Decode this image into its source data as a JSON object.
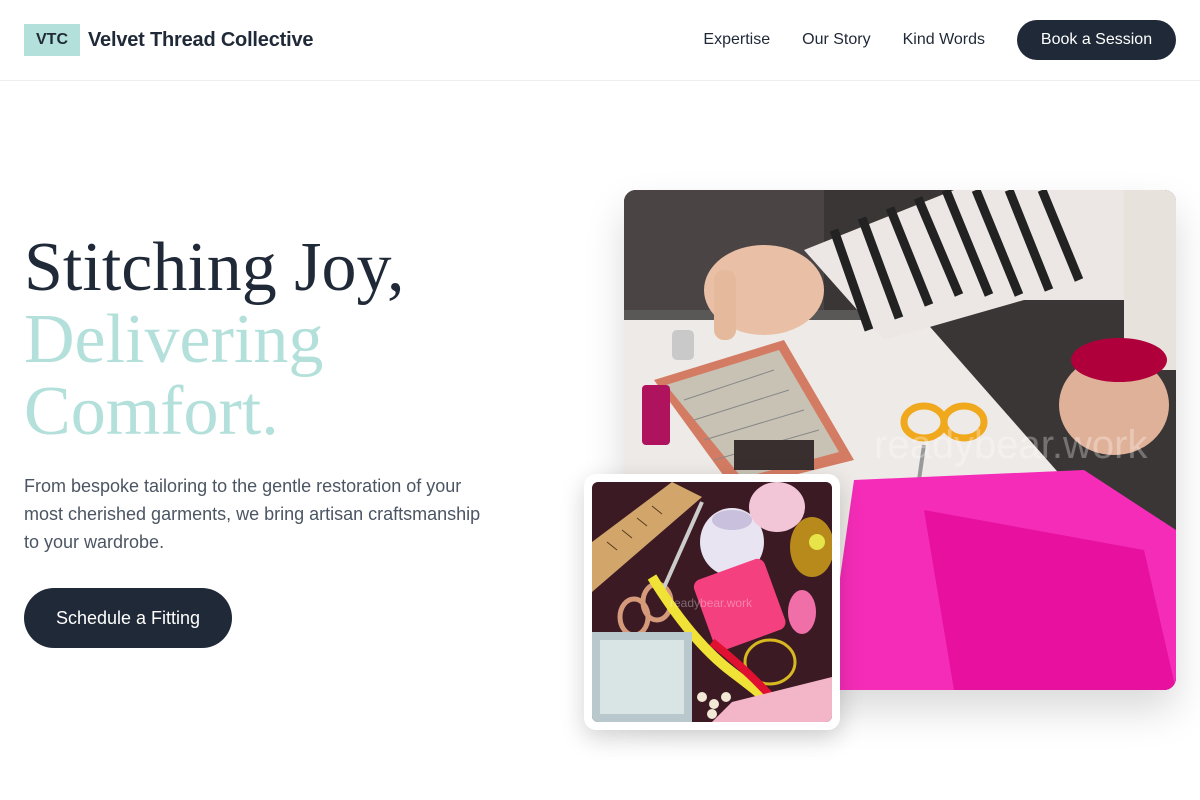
{
  "header": {
    "logo": "VTC",
    "brand_name": "Velvet Thread Collective",
    "nav": [
      "Expertise",
      "Our Story",
      "Kind Words"
    ],
    "cta": "Book a Session"
  },
  "hero": {
    "title_line1": "Stitching Joy,",
    "title_line2a": "Delivering",
    "title_line2b": "Comfort.",
    "description": "From bespoke tailoring to the gentle restoration of your most cherished garments, we bring artisan craftsmanship to your wardrobe.",
    "cta": "Schedule a Fitting"
  },
  "images": {
    "main_watermark": "readybear.work",
    "small_watermark": "readybear.work"
  },
  "colors": {
    "primary": "#1f2937",
    "accent": "#b3e0da",
    "text_muted": "#4b5563"
  }
}
